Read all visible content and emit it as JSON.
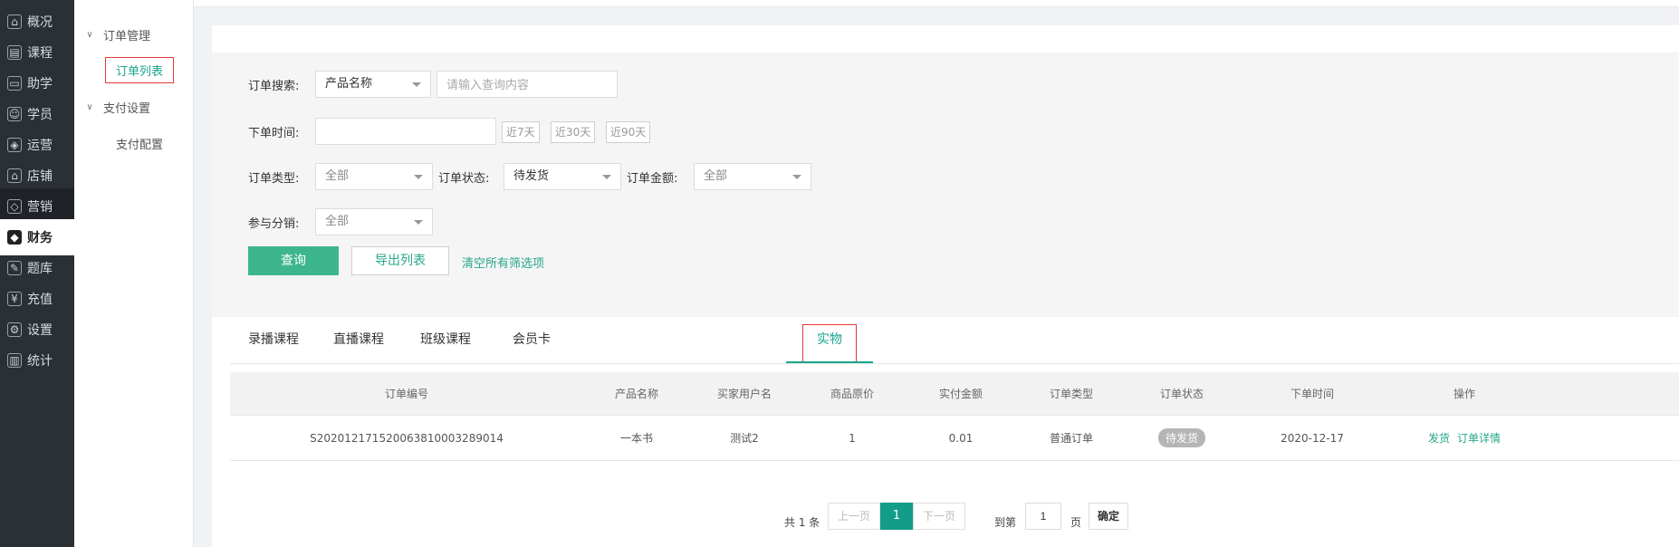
{
  "nav": {
    "items": [
      {
        "label": "概况",
        "icon": "dashboard-icon"
      },
      {
        "label": "课程",
        "icon": "book-icon"
      },
      {
        "label": "助学",
        "icon": "briefcase-icon"
      },
      {
        "label": "学员",
        "icon": "user-icon"
      },
      {
        "label": "运营",
        "icon": "cube-icon"
      },
      {
        "label": "店铺",
        "icon": "store-icon"
      },
      {
        "label": "营销",
        "icon": "tag-icon"
      },
      {
        "label": "财务",
        "icon": "finance-icon"
      },
      {
        "label": "题库",
        "icon": "pencil-icon"
      },
      {
        "label": "充值",
        "icon": "yen-icon"
      },
      {
        "label": "设置",
        "icon": "gear-icon"
      },
      {
        "label": "统计",
        "icon": "bar-chart-icon"
      }
    ]
  },
  "subnav": {
    "group1": "订单管理",
    "group1_item": "订单列表",
    "group2": "支付设置",
    "group2_item": "支付配置"
  },
  "filter": {
    "search_label": "订单搜索:",
    "search_field_select": "产品名称",
    "search_placeholder": "请输入查询内容",
    "time_label": "下单时间:",
    "quick_7": "近7天",
    "quick_30": "近30天",
    "quick_90": "近90天",
    "type_label": "订单类型:",
    "type_value": "全部",
    "status_label": "订单状态:",
    "status_value": "待发货",
    "amount_label": "订单金额:",
    "amount_value": "全部",
    "distribution_label": "参与分销:",
    "distribution_value": "全部",
    "query_button": "查询",
    "export_button": "导出列表",
    "clear_link": "清空所有筛选项"
  },
  "tabs": [
    "录播课程",
    "直播课程",
    "班级课程",
    "会员卡",
    "实物"
  ],
  "table": {
    "headers": [
      "订单编号",
      "产品名称",
      "买家用户名",
      "商品原价",
      "实付金额",
      "订单类型",
      "订单状态",
      "下单时间",
      "操作"
    ],
    "rows": [
      {
        "order_no": "S20201217152006381000328901​4",
        "product": "一本书",
        "buyer": "测试2",
        "original_price": "1",
        "paid": "0.01",
        "type": "普通订单",
        "status": "待发货",
        "date": "2020-12-17",
        "op_ship": "发货",
        "op_detail": "订单详情"
      }
    ]
  },
  "pagination": {
    "total": "共 1 条",
    "prev": "上一页",
    "current": "1",
    "next": "下一页",
    "goto_label": "到第",
    "goto_value": "1",
    "page_suffix": "页",
    "confirm": "确定"
  }
}
